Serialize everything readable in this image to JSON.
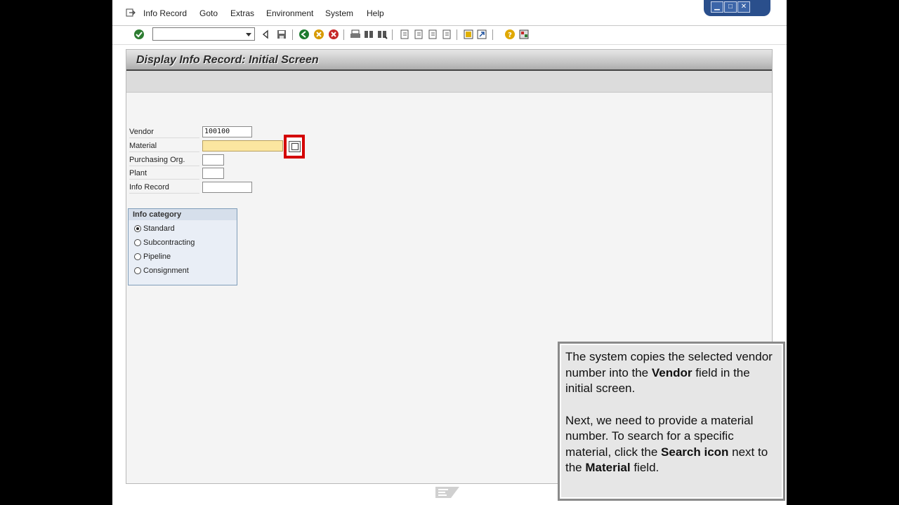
{
  "menu": {
    "items": [
      {
        "label": "Info Record"
      },
      {
        "label": "Goto"
      },
      {
        "label": "Extras"
      },
      {
        "label": "Environment"
      },
      {
        "label": "System"
      },
      {
        "label": "Help"
      }
    ]
  },
  "window_controls": {
    "minimize": "▁",
    "maximize": "□",
    "close": "✕"
  },
  "page": {
    "title": "Display Info Record: Initial Screen"
  },
  "form": {
    "vendor": {
      "label": "Vendor",
      "value": "100100"
    },
    "material": {
      "label": "Material",
      "value": ""
    },
    "purchasing_org": {
      "label": "Purchasing Org.",
      "value": ""
    },
    "plant": {
      "label": "Plant",
      "value": ""
    },
    "info_record": {
      "label": "Info Record",
      "value": ""
    }
  },
  "info_category": {
    "title": "Info category",
    "options": [
      {
        "label": "Standard",
        "selected": true
      },
      {
        "label": "Subcontracting",
        "selected": false
      },
      {
        "label": "Pipeline",
        "selected": false
      },
      {
        "label": "Consignment",
        "selected": false
      }
    ]
  },
  "tutorial": {
    "p1_a": "The system copies the selected vendor number into the ",
    "p1_b": "Vendor",
    "p1_c": " field in the initial screen.",
    "p2_a": "Next, we need to provide a material number. To search for a specific material, click the ",
    "p2_b": "Search icon",
    "p2_c": " next to the ",
    "p2_d": "Material",
    "p2_e": " field."
  },
  "colors": {
    "highlight": "#d40000",
    "required_field": "#fbe6a0",
    "window_blue": "#2a4f8c"
  }
}
